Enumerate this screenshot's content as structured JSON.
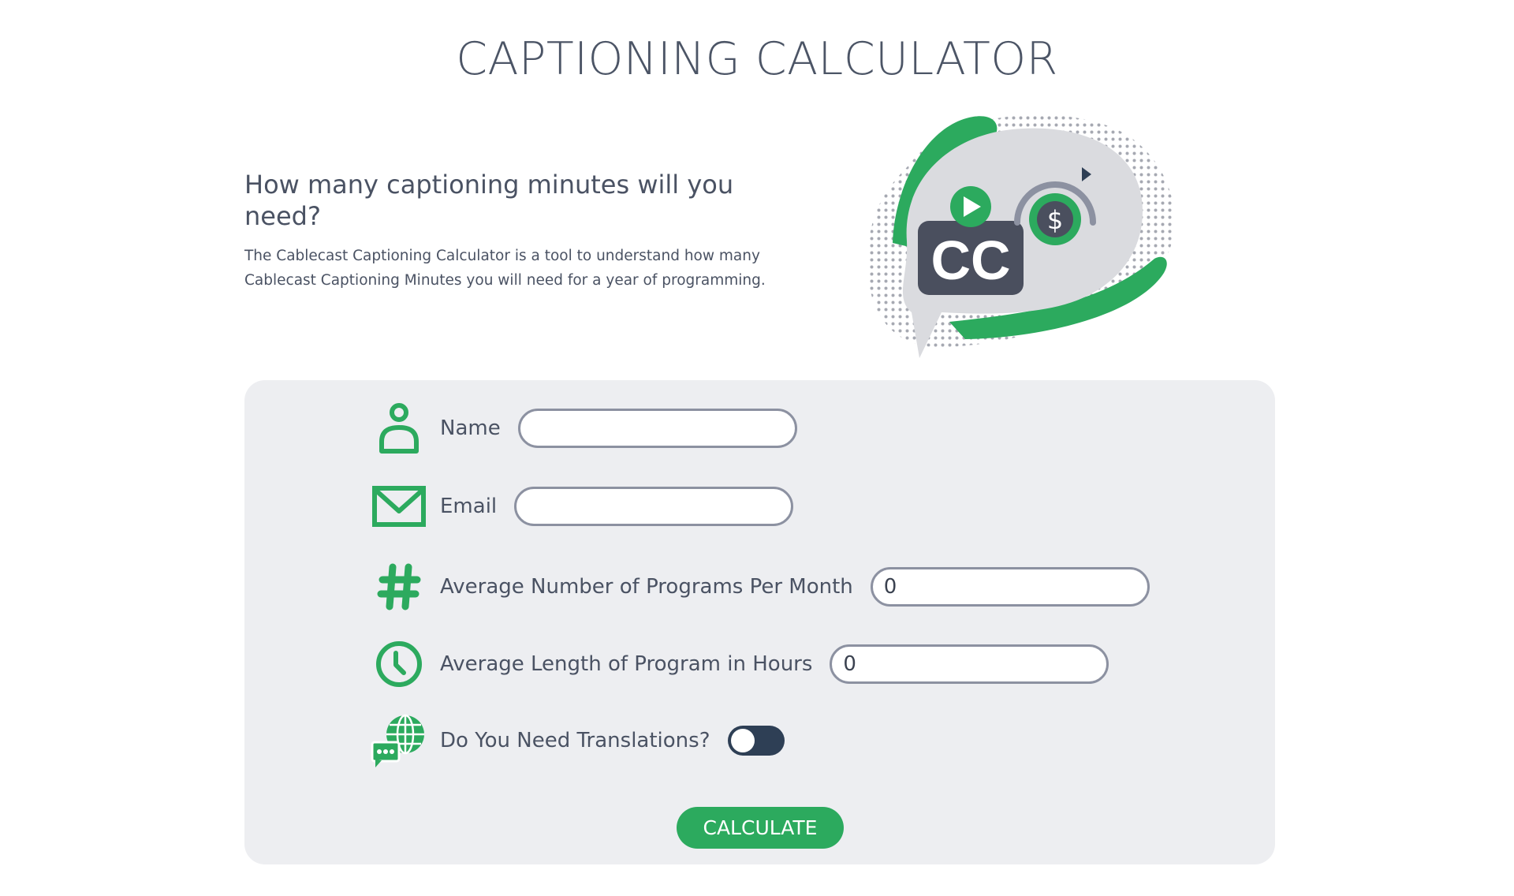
{
  "page": {
    "title": "CAPTIONING CALCULATOR"
  },
  "intro": {
    "heading": "How many captioning minutes will you need?",
    "description": "The Cablecast Captioning Calculator is a tool to understand how many Cablecast Captioning Minutes you will need for a year of programming."
  },
  "illustration": {
    "cc_text": "CC",
    "dollar_text": "$",
    "icon": "captioning-cost-illustration"
  },
  "form": {
    "fields": [
      {
        "icon": "person-icon",
        "label": "Name",
        "value": "",
        "placeholder": ""
      },
      {
        "icon": "envelope-icon",
        "label": "Email",
        "value": "",
        "placeholder": ""
      },
      {
        "icon": "hashtag-icon",
        "label": "Average Number of Programs Per Month",
        "value": "0",
        "placeholder": ""
      },
      {
        "icon": "clock-icon",
        "label": "Average Length of Program in Hours",
        "value": "0",
        "placeholder": ""
      }
    ],
    "translations": {
      "icon": "globe-chat-icon",
      "label": "Do You Need Translations?",
      "enabled": false
    },
    "submit_label": "CALCULATE"
  },
  "colors": {
    "accent_green": "#2caa5e",
    "text_gray": "#4a5263",
    "panel_bg": "#edeef1",
    "toggle_dark": "#2e3f55",
    "input_border": "#8c91a1"
  }
}
